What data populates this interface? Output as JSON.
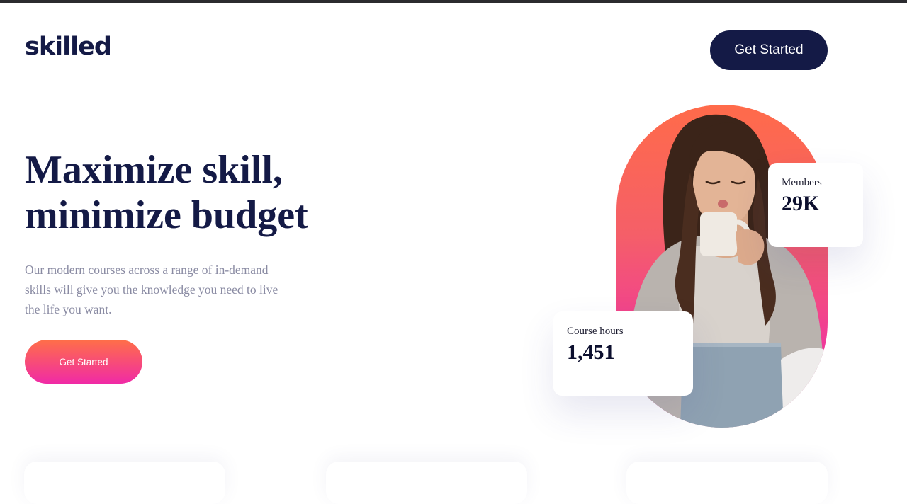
{
  "brand": {
    "logo_text": "skilled"
  },
  "header": {
    "cta_label": "Get Started"
  },
  "hero": {
    "title_line1": "Maximize skill,",
    "title_line2": "minimize budget",
    "description": "Our modern courses across a range of in-demand skills will give you the knowledge you need to live the life you want.",
    "cta_label": "Get Started"
  },
  "stats": {
    "members": {
      "label": "Members",
      "value": "29K"
    },
    "course_hours": {
      "label": "Course hours",
      "value": "1,451"
    }
  },
  "colors": {
    "navy": "#141a46",
    "gradient_start": "#ff6f48",
    "gradient_end": "#f02aa6",
    "body_text": "#8a8ba3"
  }
}
